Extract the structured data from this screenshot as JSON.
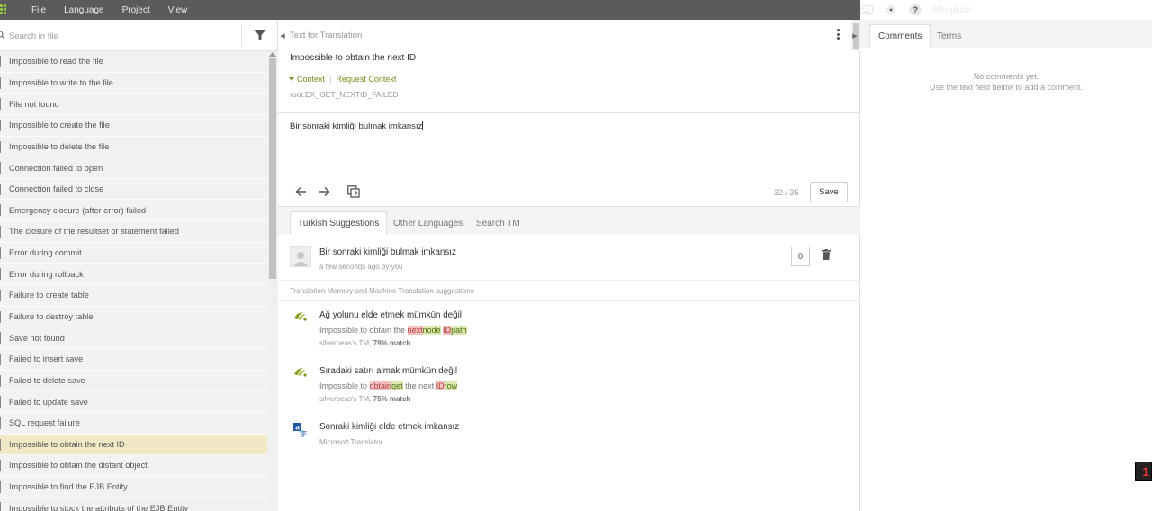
{
  "topbar": {
    "menu": [
      "File",
      "Language",
      "Project",
      "View"
    ],
    "username": "btknutizer",
    "icons": [
      "grid-icon",
      "keyboard-icon",
      "gear-icon",
      "help-icon"
    ],
    "bg_color": "#5b5b5b"
  },
  "left": {
    "search_placeholder": "Search in file",
    "strings": [
      "Impossible to read the file",
      "Impossible to write to the file",
      "File not found",
      "Impossible to create the file",
      "Impossible to delete the file",
      "Connection failed to open",
      "Connection failed to close",
      "Emergency closure (after error) failed",
      "The closure of the resultset or statement failed",
      "Error during commit",
      "Error during rollback",
      "Failure to create table",
      "Failure to destroy table",
      "Save not found",
      "Failed to insert save",
      "Failed to delete save",
      "Failed to update save",
      "SQL request failure",
      "Impossible to obtain the next ID",
      "Impossible to obtain the distant object",
      "Impossible to find the EJB Entity",
      "Impossible to stock the attributs of the EJB Entity"
    ],
    "active_index": 18,
    "active_color": "#f1e8c6"
  },
  "editor": {
    "source_heading": "Text for Translation",
    "source_text": "Impossible to obtain the next ID",
    "context_label": "Context",
    "request_context_label": "Request Context",
    "key": "root.EX_GET_NEXTID_FAILED",
    "translation": "Bir sonraki kimliği bulmak imkansız",
    "counter": "32 / 35",
    "save_label": "Save",
    "accent_color": "#7a8a1e"
  },
  "suggestions": {
    "tabs": [
      "Turkish Suggestions",
      "Other Languages",
      "Search TM"
    ],
    "own": {
      "text": "Bir sonraki kimliği bulmak imkansız",
      "meta": "a few seconds ago by you",
      "votes": "0"
    },
    "tm_header": "Translation Memory and Machine Translation suggestions",
    "tm": [
      {
        "text": "Ağ yolunu elde etmek mümkün değil",
        "src_prefix": "Impossible to obtain the ",
        "del1": "next",
        "ins1": "node",
        "mid": " ",
        "del2": "ID",
        "ins2": "path",
        "source_name": "silverpeas's TM, ",
        "match": "79% match"
      },
      {
        "text": "Sıradaki satırı almak mümkün değil",
        "src_prefix": "Impossible to ",
        "del1": "obtain",
        "ins1": "get",
        "mid": " the next ",
        "del2": "ID",
        "ins2": "row",
        "source_name": "silverpeas's TM, ",
        "match": "75% match"
      }
    ],
    "mt": {
      "text": "Sonraki kimliği elde etmek imkansız",
      "source_name": "Microsoft Translator"
    }
  },
  "comments": {
    "tabs": [
      "Comments",
      "Terms"
    ],
    "empty_line1": "No comments yet.",
    "empty_line2": "Use the text field below to add a comment."
  },
  "badge": "1"
}
